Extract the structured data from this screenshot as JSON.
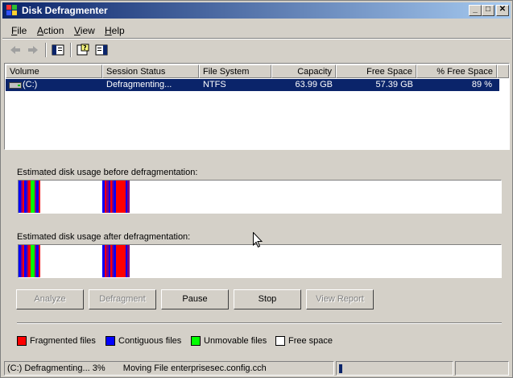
{
  "window": {
    "title": "Disk Defragmenter",
    "controls": {
      "minimize": "_",
      "maximize": "□",
      "close": "✕"
    }
  },
  "menu": [
    {
      "label": "File"
    },
    {
      "label": "Action"
    },
    {
      "label": "View"
    },
    {
      "label": "Help"
    }
  ],
  "toolbar": {
    "icons": [
      "back-arrow-icon",
      "forward-arrow-icon",
      "show-hide-console-tree-icon",
      "help-icon",
      "properties-icon"
    ]
  },
  "list": {
    "columns": [
      "Volume",
      "Session Status",
      "File System",
      "Capacity",
      "Free Space",
      "% Free Space"
    ],
    "rows": [
      {
        "volume": "(C:)",
        "status": "Defragmenting...",
        "fs": "NTFS",
        "capacity": "63.99 GB",
        "free": "57.39 GB",
        "pct": "89 %"
      }
    ]
  },
  "analysis": {
    "before_label": "Estimated disk usage before defragmentation:",
    "after_label": "Estimated disk usage after defragmentation:"
  },
  "buttons": {
    "analyze": "Analyze",
    "defragment": "Defragment",
    "pause": "Pause",
    "stop": "Stop",
    "view_report": "View Report"
  },
  "legend": [
    {
      "label": "Fragmented files",
      "color": "#ff0000"
    },
    {
      "label": "Contiguous files",
      "color": "#0000ff"
    },
    {
      "label": "Unmovable files",
      "color": "#00ff00"
    },
    {
      "label": "Free space",
      "color": "#ffffff"
    }
  ],
  "status": {
    "progress_text": "(C:) Defragmenting... 3%",
    "action_text": "Moving File enterprisesec.config.cch",
    "progress_fraction": 0.03
  },
  "colors": {
    "selection": "#0a246a",
    "fragmented": "#ff0000",
    "contiguous": "#0000ff",
    "unmovable": "#00ff00",
    "purple": "#800080"
  }
}
